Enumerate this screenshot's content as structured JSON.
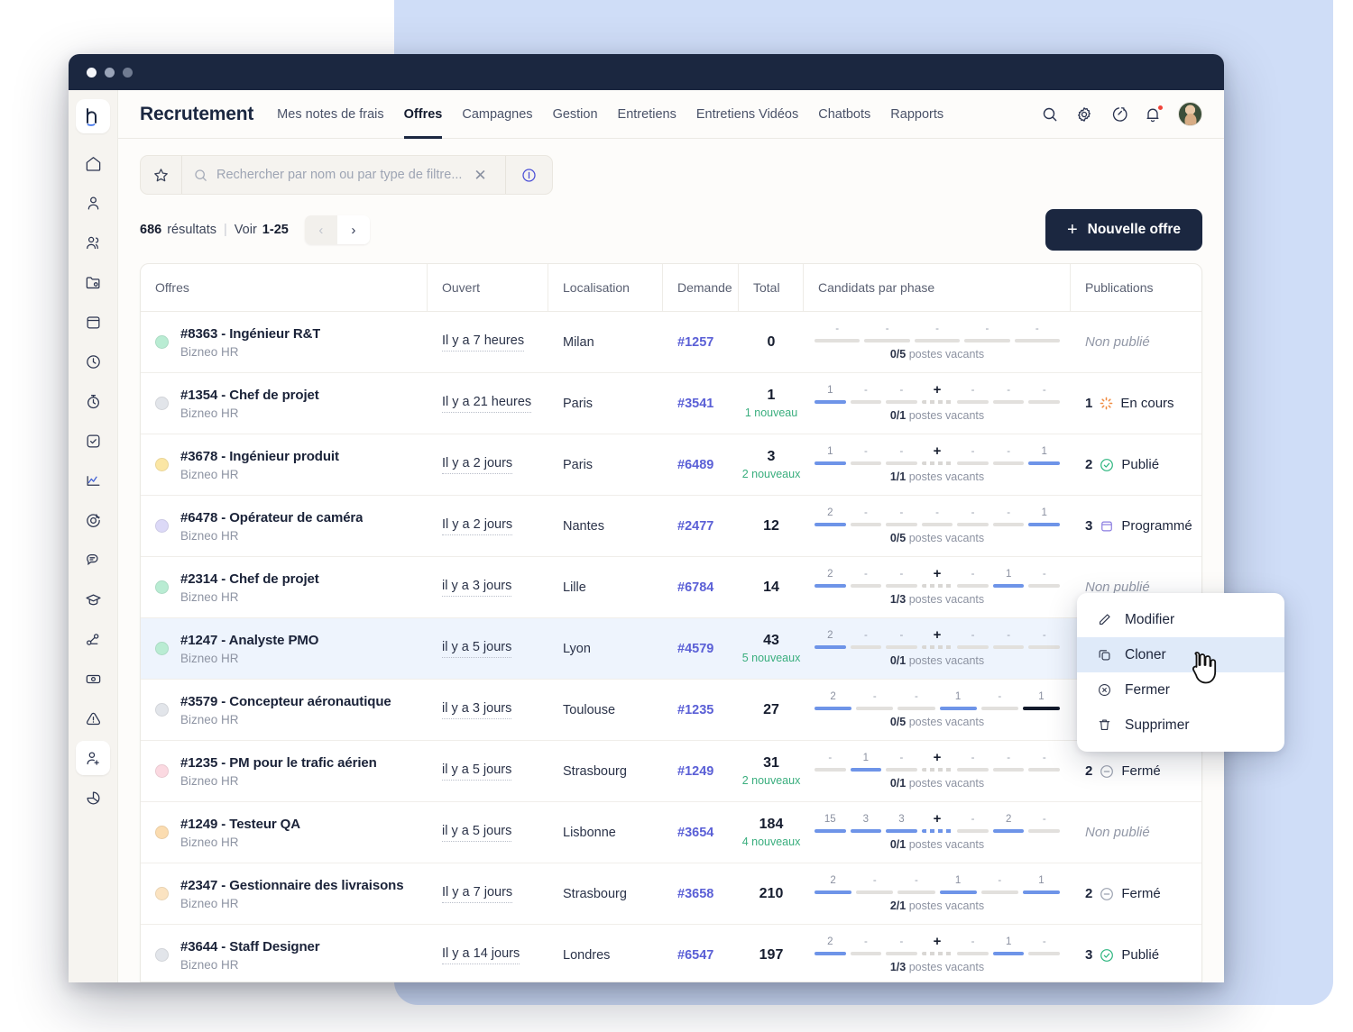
{
  "window": {
    "titlebar_dots": [
      "active",
      "inactive",
      "inactive"
    ]
  },
  "sidebar": {
    "logo": "logo-h",
    "items": [
      {
        "icon": "home-icon",
        "name": "home"
      },
      {
        "icon": "user-icon",
        "name": "profile"
      },
      {
        "icon": "users-icon",
        "name": "teams"
      },
      {
        "icon": "folder-icon",
        "name": "documents"
      },
      {
        "icon": "calendar-icon",
        "name": "calendar"
      },
      {
        "icon": "clock-icon",
        "name": "time"
      },
      {
        "icon": "stopwatch-icon",
        "name": "timer"
      },
      {
        "icon": "check-square-icon",
        "name": "tasks"
      },
      {
        "icon": "chart-line-icon",
        "name": "analytics"
      },
      {
        "icon": "target-icon",
        "name": "objectives"
      },
      {
        "icon": "chat-icon",
        "name": "messages"
      },
      {
        "icon": "graduation-icon",
        "name": "learning"
      },
      {
        "icon": "workflow-icon",
        "name": "workflows"
      },
      {
        "icon": "money-icon",
        "name": "payroll"
      },
      {
        "icon": "alert-icon",
        "name": "alerts"
      },
      {
        "icon": "user-plus-icon",
        "name": "recruitment",
        "active": true
      },
      {
        "icon": "pie-chart-icon",
        "name": "reports"
      }
    ]
  },
  "topnav": {
    "brand": "Recrutement",
    "links": [
      {
        "label": "Mes notes de frais",
        "active": false
      },
      {
        "label": "Offres",
        "active": true
      },
      {
        "label": "Campagnes",
        "active": false
      },
      {
        "label": "Gestion",
        "active": false
      },
      {
        "label": "Entretiens",
        "active": false
      },
      {
        "label": "Entretiens Vidéos",
        "active": false
      },
      {
        "label": "Chatbots",
        "active": false
      },
      {
        "label": "Rapports",
        "active": false
      }
    ],
    "icons": [
      {
        "name": "search-icon"
      },
      {
        "name": "gear-icon"
      },
      {
        "name": "speedometer-icon"
      },
      {
        "name": "bell-icon",
        "badge": true
      }
    ],
    "avatar": "user-avatar"
  },
  "search": {
    "placeholder": "Rechercher par nom ou par type de filtre...",
    "star_icon": "star-icon",
    "search_icon": "search-icon",
    "clear_icon": "close-icon",
    "info_icon": "info-icon"
  },
  "results": {
    "count": "686",
    "count_label": "résultats",
    "view_label": "Voir",
    "range": "1-25",
    "prev_icon": "chevron-left-icon",
    "next_icon": "chevron-right-icon"
  },
  "new_offer_button": {
    "plus": "+",
    "label": "Nouvelle offre"
  },
  "table": {
    "columns": [
      "Offres",
      "Ouvert",
      "Localisation",
      "Demande",
      "Total",
      "Candidats par phase",
      "Publications"
    ],
    "vacancy_label": "postes vacants",
    "rows": [
      {
        "dot_color": "#b9ecd3",
        "title": "#8363 - Ingénieur R&T",
        "company": "Bizneo HR",
        "ouvert": "Il y a 7 heures",
        "localisation": "Milan",
        "demande": "#1257",
        "total": "0",
        "new": "",
        "phase_nums": [
          "-",
          "-",
          "-",
          "-",
          "-"
        ],
        "phase_bars": [
          "off",
          "off",
          "off",
          "off",
          "off"
        ],
        "vacancies": "0/5",
        "publication_count": "",
        "publication_status": "Non publié",
        "publication_icon": "none"
      },
      {
        "dot_color": "#e2e5ea",
        "title": "#1354 - Chef de projet",
        "company": "Bizneo HR",
        "ouvert": "Il y a 21 heures",
        "localisation": "Paris",
        "demande": "#3541",
        "total": "1",
        "new": "1 nouveau",
        "phase_nums": [
          "1",
          "-",
          "-",
          "+",
          "-",
          "-",
          "-"
        ],
        "phase_bars": [
          "on",
          "off",
          "off",
          "dash",
          "off",
          "off",
          "off"
        ],
        "vacancies": "0/1",
        "publication_count": "1",
        "publication_status": "En cours",
        "publication_icon": "spinner-icon"
      },
      {
        "dot_color": "#fbe6a4",
        "title": "#3678 - Ingénieur produit",
        "company": "Bizneo HR",
        "ouvert": "Il y a 2 jours",
        "localisation": "Paris",
        "demande": "#6489",
        "total": "3",
        "new": "2 nouveaux",
        "phase_nums": [
          "1",
          "-",
          "-",
          "+",
          "-",
          "-",
          "1"
        ],
        "phase_bars": [
          "on",
          "off",
          "off",
          "dash",
          "off",
          "off",
          "on"
        ],
        "vacancies": "1/1",
        "publication_count": "2",
        "publication_status": "Publié",
        "publication_icon": "check-circle-icon"
      },
      {
        "dot_color": "#dcd9f7",
        "title": "#6478 - Opérateur de caméra",
        "company": "Bizneo HR",
        "ouvert": "Il y a 2 jours",
        "localisation": "Nantes",
        "demande": "#2477",
        "total": "12",
        "new": "",
        "phase_nums": [
          "2",
          "-",
          "-",
          "-",
          "-",
          "-",
          "1"
        ],
        "phase_bars": [
          "on",
          "off",
          "off",
          "off",
          "off",
          "off",
          "on"
        ],
        "vacancies": "0/5",
        "publication_count": "3",
        "publication_status": "Programmé",
        "publication_icon": "calendar-box-icon"
      },
      {
        "dot_color": "#b9ecd3",
        "title": "#2314 - Chef de projet",
        "company": "Bizneo HR",
        "ouvert": "il y a 3 jours",
        "localisation": "Lille",
        "demande": "#6784",
        "total": "14",
        "new": "",
        "phase_nums": [
          "2",
          "-",
          "-",
          "+",
          "-",
          "1",
          "-"
        ],
        "phase_bars": [
          "on",
          "off",
          "off",
          "dash",
          "off",
          "on",
          "off"
        ],
        "vacancies": "1/3",
        "publication_count": "",
        "publication_status": "Non publié",
        "publication_icon": "none"
      },
      {
        "dot_color": "#b9ecd3",
        "title": "#1247 - Analyste PMO",
        "company": "Bizneo HR",
        "ouvert": "il y a 5 jours",
        "localisation": "Lyon",
        "demande": "#4579",
        "total": "43",
        "new": "5 nouveaux",
        "selected": true,
        "phase_nums": [
          "2",
          "-",
          "-",
          "+",
          "-",
          "-",
          "-"
        ],
        "phase_bars": [
          "on",
          "off",
          "off",
          "dash",
          "off",
          "off",
          "off"
        ],
        "vacancies": "0/1",
        "publication_count": "",
        "publication_status": "",
        "publication_icon": "none"
      },
      {
        "dot_color": "#e2e5ea",
        "title": "#3579 - Concepteur aéronautique",
        "company": "Bizneo HR",
        "ouvert": "il y a 3 jours",
        "localisation": "Toulouse",
        "demande": "#1235",
        "total": "27",
        "new": "",
        "phase_nums": [
          "2",
          "-",
          "-",
          "1",
          "-",
          "1"
        ],
        "phase_bars": [
          "on",
          "off",
          "off",
          "on",
          "off",
          "dark"
        ],
        "vacancies": "0/5",
        "publication_count": "",
        "publication_status": "",
        "publication_icon": "none"
      },
      {
        "dot_color": "#fbd9e1",
        "title": "#1235 - PM pour le trafic aérien",
        "company": "Bizneo HR",
        "ouvert": "il y a 5 jours",
        "localisation": "Strasbourg",
        "demande": "#1249",
        "total": "31",
        "new": "2 nouveaux",
        "phase_nums": [
          "-",
          "1",
          "-",
          "+",
          "-",
          "-",
          "-"
        ],
        "phase_bars": [
          "off",
          "on",
          "off",
          "dash",
          "off",
          "off",
          "off"
        ],
        "vacancies": "0/1",
        "publication_count": "2",
        "publication_status": "Fermé",
        "publication_icon": "minus-circle-icon"
      },
      {
        "dot_color": "#fbdcb0",
        "title": "#1249 - Testeur QA",
        "company": "Bizneo HR",
        "ouvert": "il y a 5 jours",
        "localisation": "Lisbonne",
        "demande": "#3654",
        "total": "184",
        "new": "4 nouveaux",
        "phase_nums": [
          "15",
          "3",
          "3",
          "+",
          "-",
          "2",
          "-"
        ],
        "phase_bars": [
          "on",
          "on",
          "on",
          "dash-on",
          "off",
          "on",
          "off"
        ],
        "vacancies": "0/1",
        "publication_count": "",
        "publication_status": "Non publié",
        "publication_icon": "none"
      },
      {
        "dot_color": "#fbe3c1",
        "title": "#2347 - Gestionnaire des livraisons",
        "company": "Bizneo HR",
        "ouvert": "Il y a 7 jours",
        "localisation": "Strasbourg",
        "demande": "#3658",
        "total": "210",
        "new": "",
        "phase_nums": [
          "2",
          "-",
          "-",
          "1",
          "-",
          "1"
        ],
        "phase_bars": [
          "on",
          "off",
          "off",
          "on",
          "off",
          "on"
        ],
        "vacancies": "2/1",
        "publication_count": "2",
        "publication_status": "Fermé",
        "publication_icon": "minus-circle-icon"
      },
      {
        "dot_color": "#e2e5ea",
        "title": "#3644 - Staff Designer",
        "company": "Bizneo HR",
        "ouvert": "Il y a 14 jours",
        "localisation": "Londres",
        "demande": "#6547",
        "total": "197",
        "new": "",
        "phase_nums": [
          "2",
          "-",
          "-",
          "+",
          "-",
          "1",
          "-"
        ],
        "phase_bars": [
          "on",
          "off",
          "off",
          "dash",
          "off",
          "on",
          "off"
        ],
        "vacancies": "1/3",
        "publication_count": "3",
        "publication_status": "Publié",
        "publication_icon": "check-circle-icon"
      }
    ]
  },
  "context_menu": {
    "items": [
      {
        "label": "Modifier",
        "icon": "pencil-icon",
        "highlighted": false
      },
      {
        "label": "Cloner",
        "icon": "copy-icon",
        "highlighted": true
      },
      {
        "label": "Fermer",
        "icon": "x-circle-icon",
        "highlighted": false
      },
      {
        "label": "Supprimer",
        "icon": "trash-icon",
        "highlighted": false
      }
    ]
  },
  "colors": {
    "window_chrome": "#1b2740",
    "accent_blue": "#6e94e8",
    "link_purple": "#5a5fd6",
    "success_green": "#3aae7e",
    "panel_blue": "#cfddf7"
  }
}
